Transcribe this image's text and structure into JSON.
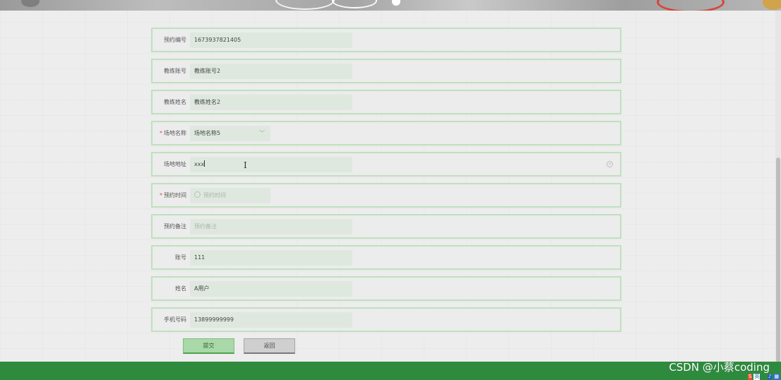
{
  "form": {
    "rows": [
      {
        "label": "预约编号",
        "required": false,
        "value": "1673937821405",
        "placeholder": ""
      },
      {
        "label": "教练账号",
        "required": false,
        "value": "教练账号2",
        "placeholder": ""
      },
      {
        "label": "教练姓名",
        "required": false,
        "value": "教练姓名2",
        "placeholder": ""
      },
      {
        "label": "场地名称",
        "required": true,
        "value": "场地名称5",
        "placeholder": ""
      },
      {
        "label": "场地地址",
        "required": false,
        "value": "xxx",
        "placeholder": ""
      },
      {
        "label": "预约时间",
        "required": true,
        "value": "",
        "placeholder": "预约时间"
      },
      {
        "label": "预约备注",
        "required": false,
        "value": "",
        "placeholder": "预约备注"
      },
      {
        "label": "账号",
        "required": false,
        "value": "111",
        "placeholder": ""
      },
      {
        "label": "姓名",
        "required": false,
        "value": "A用户",
        "placeholder": ""
      },
      {
        "label": "手机号码",
        "required": false,
        "value": "13899999999",
        "placeholder": ""
      }
    ],
    "required_mark": "*",
    "buttons": {
      "submit": "提交",
      "back": "返回"
    }
  },
  "watermark": "CSDN @小蔡coding",
  "tray": {
    "ime_logo": "S",
    "ime_mode": "英",
    "punct": "·,",
    "mic": "♪",
    "keyboard": "▦"
  },
  "colors": {
    "accent_green": "#2e8b3e",
    "row_border": "#bfe0bf",
    "field_bg": "#dfe8df",
    "required_red": "#e04b4b"
  }
}
